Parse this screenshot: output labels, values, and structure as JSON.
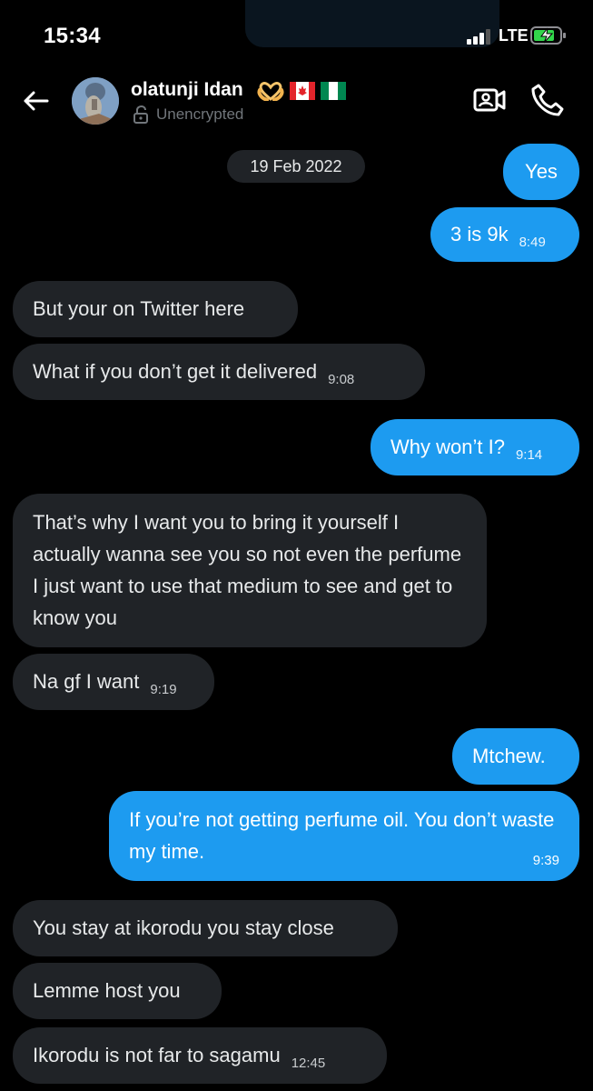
{
  "status_bar": {
    "time": "15:34",
    "network": "LTE"
  },
  "header": {
    "contact_name": "olatunji Idan",
    "emojis": [
      "heart-hands-emoji",
      "canada-flag-emoji",
      "nigeria-flag-emoji"
    ],
    "encryption_status": "Unencrypted"
  },
  "date_separator": "19 Feb 2022",
  "messages": [
    {
      "dir": "out",
      "text": "Yes",
      "time": ""
    },
    {
      "dir": "out",
      "text": "3 is 9k",
      "time": "8:49"
    },
    {
      "dir": "in",
      "text": "But your on Twitter here",
      "time": ""
    },
    {
      "dir": "in",
      "text": "What if you don’t get it delivered",
      "time": "9:08"
    },
    {
      "dir": "out",
      "text": "Why won’t I?",
      "time": "9:14"
    },
    {
      "dir": "in",
      "text": "That’s why I want you to bring it yourself I actually wanna see you so not even the perfume I just want to use that medium to see and get to know you",
      "time": ""
    },
    {
      "dir": "in",
      "text": "Na gf I want",
      "time": "9:19"
    },
    {
      "dir": "out",
      "text": "Mtchew.",
      "time": ""
    },
    {
      "dir": "out",
      "text": "If you’re not getting perfume oil. You don’t waste my time.",
      "time": "9:39"
    },
    {
      "dir": "in",
      "text": "You stay at ikorodu you stay close",
      "time": ""
    },
    {
      "dir": "in",
      "text": "Lemme host you",
      "time": ""
    },
    {
      "dir": "in",
      "text": "Ikorodu is not far to sagamu",
      "time": "12:45"
    }
  ],
  "colors": {
    "outgoing_bubble": "#1d9bf0",
    "incoming_bubble": "#202327",
    "background": "#000000"
  }
}
